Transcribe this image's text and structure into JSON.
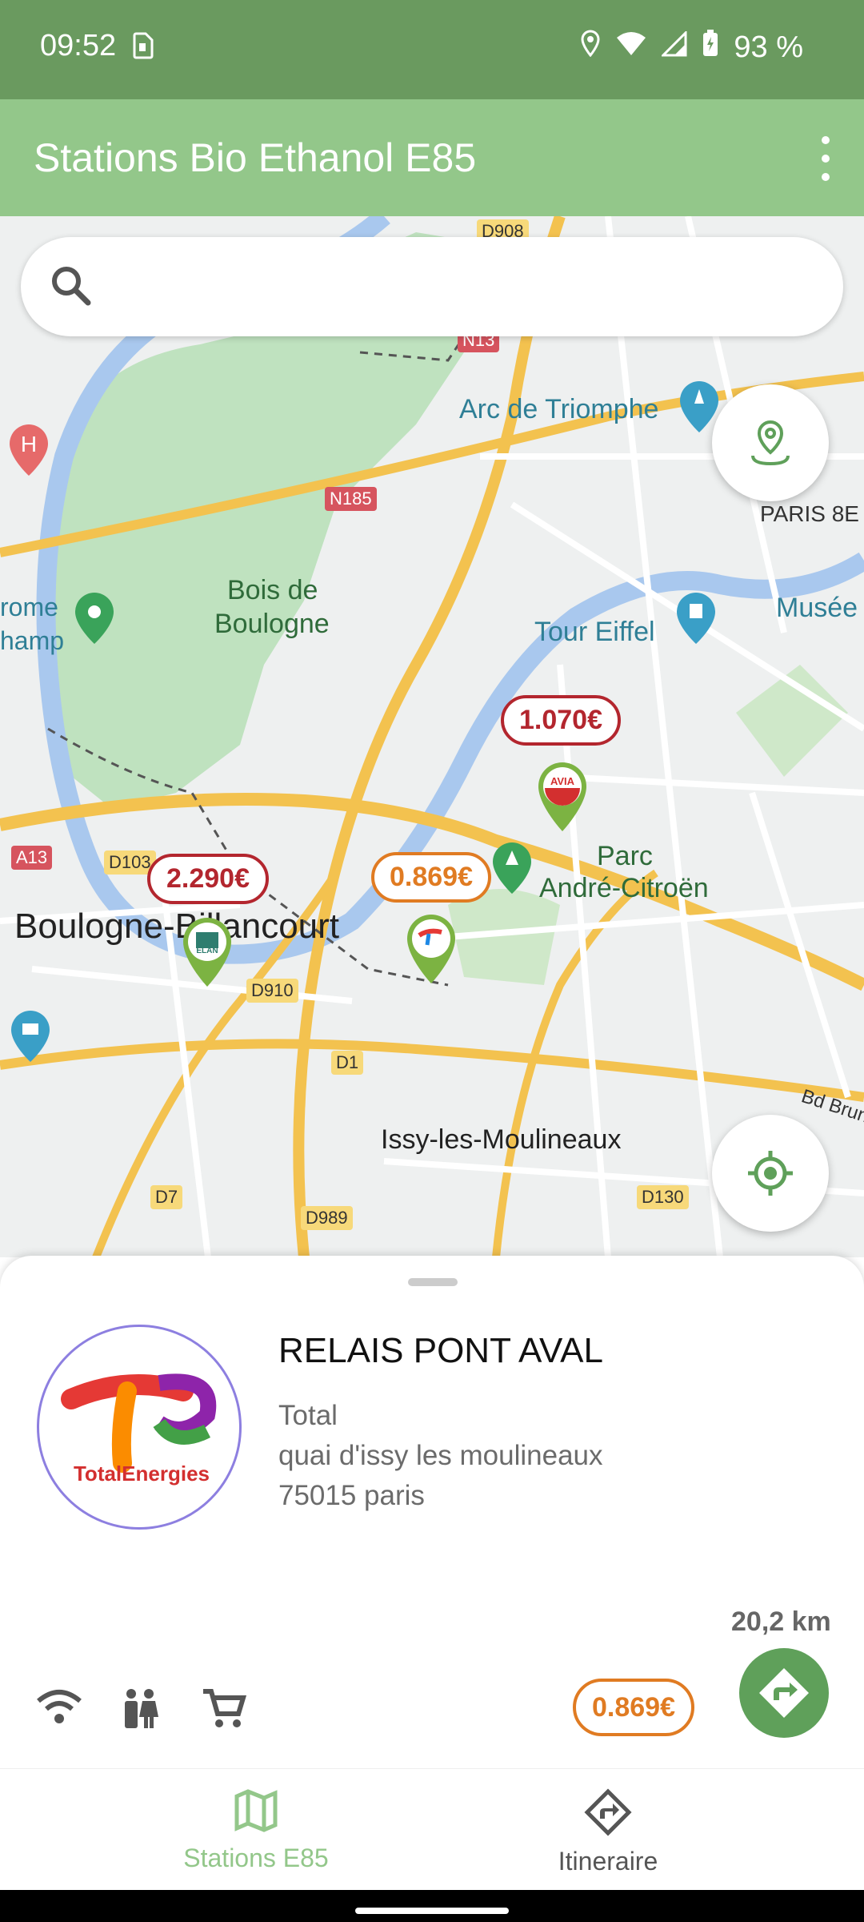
{
  "status_bar": {
    "time": "09:52",
    "battery": "93 %"
  },
  "app_bar": {
    "title": "Stations Bio Ethanol E85"
  },
  "search": {
    "placeholder": ""
  },
  "map": {
    "labels": {
      "arc": "Arc de Triomphe",
      "paris8": "PARIS 8E",
      "bois1": "Bois de",
      "bois2": "Boulogne",
      "rome1": "rome",
      "rome2": "hamp",
      "musee": "Musée",
      "eiffel": "Tour Eiffel",
      "parc1": "Parc",
      "parc2": "André-Citroën",
      "boulogne": "Boulogne-Billancourt",
      "issy": "Issy-les-Moulineaux",
      "bdbrune": "Bd Brune"
    },
    "shields": {
      "d908": "D908",
      "n13": "N13",
      "n185": "N185",
      "a13": "A13",
      "d103": "D103",
      "d910": "D910",
      "d1": "D1",
      "d7": "D7",
      "d989": "D989",
      "d130": "D130"
    },
    "stations": [
      {
        "price": "1.070€",
        "brand": "AVIA",
        "color": "#b3262e"
      },
      {
        "price": "2.290€",
        "brand": "ELAN",
        "color": "#b3262e"
      },
      {
        "price": "0.869€",
        "brand": "TotalEnergies",
        "color": "#e07b22"
      }
    ]
  },
  "sheet": {
    "name": "RELAIS PONT AVAL",
    "brand": "Total",
    "address1": "quai d'issy les moulineaux",
    "address2": "75015 paris",
    "distance": "20,2 km",
    "price": "0.869€",
    "logo_text": "TotalEnergies"
  },
  "bottom_nav": {
    "stations": "Stations E85",
    "itineraire": "Itineraire"
  },
  "colors": {
    "accent_green": "#93c78a",
    "status_green": "#6a9a5f",
    "price_orange": "#e07b22",
    "price_red": "#b3262e"
  }
}
